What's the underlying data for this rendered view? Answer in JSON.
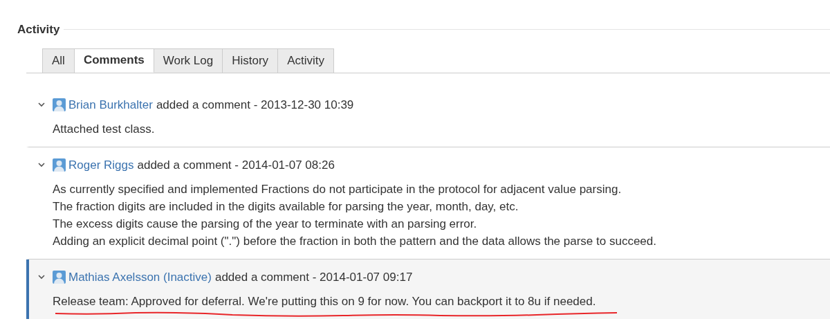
{
  "section": {
    "title": "Activity"
  },
  "tabs": [
    {
      "label": "All",
      "selected": false
    },
    {
      "label": "Comments",
      "selected": true
    },
    {
      "label": "Work Log",
      "selected": false
    },
    {
      "label": "History",
      "selected": false
    },
    {
      "label": "Activity",
      "selected": false
    }
  ],
  "comments": [
    {
      "author": "Brian Burkhalter",
      "action": "added a comment - 2013-12-30 10:39",
      "expanded": true,
      "selected": false,
      "body": [
        "Attached test class."
      ]
    },
    {
      "author": "Roger Riggs",
      "action": "added a comment - 2014-01-07 08:26",
      "expanded": true,
      "selected": false,
      "body": [
        "As currently specified and implemented Fractions do not participate in the protocol for adjacent value parsing.",
        "The fraction digits are included in the digits available for parsing the year, month, day, etc.",
        "The excess digits cause the parsing of the year to terminate with an parsing error.",
        "Adding an explicit decimal point (\".\") before the fraction in both the pattern and the data allows the parse to succeed."
      ]
    },
    {
      "author": "Mathias Axelsson (Inactive)",
      "action": "added a comment - 2014-01-07 09:17",
      "expanded": true,
      "selected": true,
      "underlined": true,
      "body": [
        "Release team: Approved for deferral. We're putting this on 9 for now. You can backport it to 8u if needed."
      ]
    }
  ]
}
